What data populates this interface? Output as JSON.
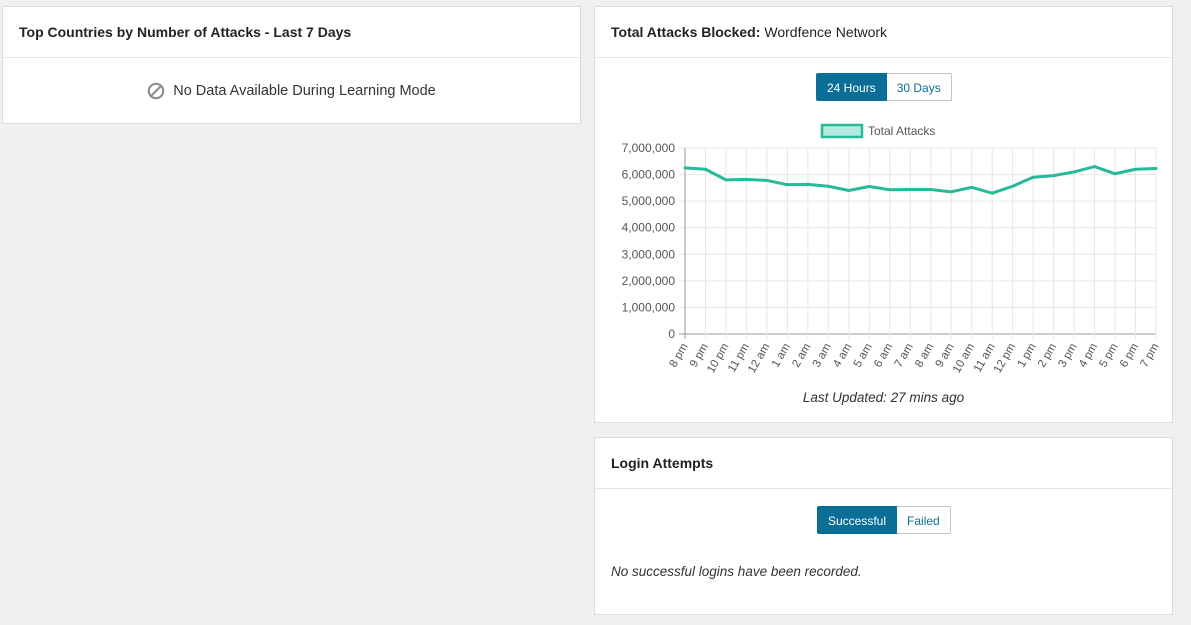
{
  "countries": {
    "title": "Top Countries by Number of Attacks - Last 7 Days",
    "no_data": "No Data Available During Learning Mode",
    "no_data_icon": "prohibited-icon"
  },
  "attacks": {
    "title_bold": "Total Attacks Blocked:",
    "title_rest": "Wordfence Network",
    "toggle": [
      "24 Hours",
      "30 Days"
    ],
    "active_toggle": "24 Hours",
    "last_updated": "Last Updated: 27 mins ago"
  },
  "logins": {
    "title": "Login Attempts",
    "toggle": [
      "Successful",
      "Failed"
    ],
    "active_toggle": "Successful",
    "empty": "No successful logins have been recorded."
  },
  "colors": {
    "series": "#26b99a",
    "series_fill": "#b5e8de",
    "accent": "#0a6e96"
  },
  "chart_data": {
    "type": "line",
    "legend": [
      "Total Attacks"
    ],
    "legend_position": "top",
    "grid": true,
    "categories": [
      "8 pm",
      "9 pm",
      "10 pm",
      "11 pm",
      "12 am",
      "1 am",
      "2 am",
      "3 am",
      "4 am",
      "5 am",
      "6 am",
      "7 am",
      "8 am",
      "9 am",
      "10 am",
      "11 am",
      "12 pm",
      "1 pm",
      "2 pm",
      "3 pm",
      "4 pm",
      "5 pm",
      "6 pm",
      "7 pm"
    ],
    "y_ticks": [
      "0",
      "1,000,000",
      "2,000,000",
      "3,000,000",
      "4,000,000",
      "5,000,000",
      "6,000,000",
      "7,000,000"
    ],
    "ylim": [
      0,
      7000000
    ],
    "series": [
      {
        "name": "Total Attacks",
        "values": [
          6250000,
          6200000,
          5800000,
          5820000,
          5780000,
          5620000,
          5630000,
          5560000,
          5400000,
          5550000,
          5430000,
          5440000,
          5440000,
          5350000,
          5520000,
          5300000,
          5560000,
          5900000,
          5960000,
          6100000,
          6300000,
          6030000,
          6200000,
          6230000
        ]
      }
    ]
  }
}
